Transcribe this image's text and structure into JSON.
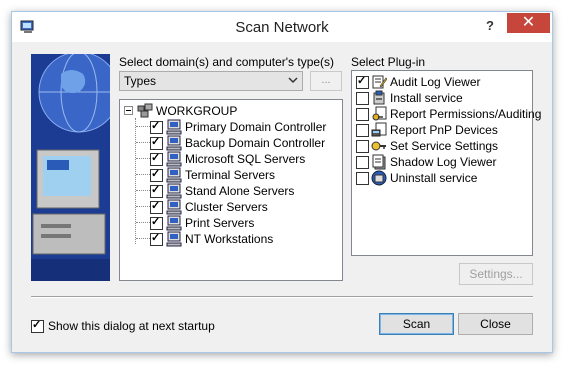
{
  "window": {
    "title": "Scan Network",
    "help_label": "?",
    "close_label": "✕"
  },
  "left_panel": {
    "domain_label": "Select domain(s) and computer's type(s)",
    "types_combo_value": "Types",
    "ellipsis_label": "...",
    "tree": {
      "root": "WORKGROUP",
      "items": [
        {
          "label": "Primary Domain Controller",
          "checked": true
        },
        {
          "label": "Backup Domain Controller",
          "checked": true
        },
        {
          "label": "Microsoft SQL Servers",
          "checked": true
        },
        {
          "label": "Terminal Servers",
          "checked": true
        },
        {
          "label": "Stand Alone Servers",
          "checked": true
        },
        {
          "label": "Cluster Servers",
          "checked": true
        },
        {
          "label": "Print Servers",
          "checked": true
        },
        {
          "label": "NT Workstations",
          "checked": true
        }
      ]
    }
  },
  "right_panel": {
    "plugin_label": "Select Plug-in",
    "plugins": [
      {
        "label": "Audit Log Viewer",
        "checked": true,
        "icon": "notepad-pencil-icon"
      },
      {
        "label": "Install service",
        "checked": false,
        "icon": "install-box-icon"
      },
      {
        "label": "Report Permissions/Auditing",
        "checked": false,
        "icon": "key-report-icon"
      },
      {
        "label": "Report PnP Devices",
        "checked": false,
        "icon": "device-report-icon"
      },
      {
        "label": "Set Service Settings",
        "checked": false,
        "icon": "service-key-icon"
      },
      {
        "label": "Shadow Log Viewer",
        "checked": false,
        "icon": "shadow-log-icon"
      },
      {
        "label": "Uninstall service",
        "checked": false,
        "icon": "uninstall-icon"
      }
    ],
    "settings_label": "Settings..."
  },
  "footer": {
    "startup_label": "Show this dialog at next startup",
    "startup_checked": true,
    "scan_label": "Scan",
    "close_label": "Close"
  },
  "colors": {
    "banner": "#1b3c92",
    "close_button": "#c7463c",
    "dialog_bg": "#f0f0f0"
  }
}
